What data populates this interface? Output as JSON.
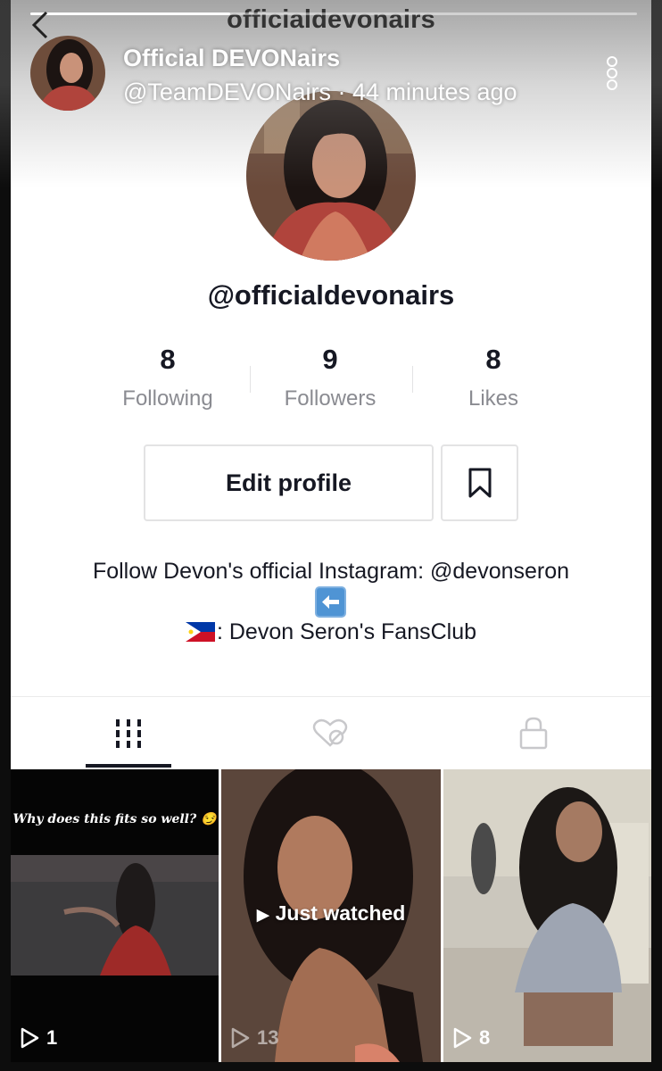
{
  "header": {
    "username": "officialdevonairs",
    "story_title": "Official DEVONairs",
    "story_meta": "@TeamDEVONairs · 44 minutes ago",
    "story_progress": 0.33
  },
  "profile": {
    "handle": "@officialdevonairs",
    "stats": [
      {
        "value": "8",
        "label": "Following"
      },
      {
        "value": "9",
        "label": "Followers"
      },
      {
        "value": "8",
        "label": "Likes"
      }
    ],
    "edit_label": "Edit profile",
    "bio_line1": "Follow Devon's official Instagram: @devonseron",
    "bio_emoji1": "back-arrow",
    "bio_line2": ": Devon Seron's FansClub",
    "bio_emoji2": "philippines-flag"
  },
  "tabs": [
    {
      "name": "videos",
      "icon": "grid-icon",
      "active": true
    },
    {
      "name": "liked",
      "icon": "liked-private-icon",
      "active": false
    },
    {
      "name": "private",
      "icon": "lock-icon",
      "active": false
    }
  ],
  "videos": [
    {
      "caption": "Why does this fits so well? 😏",
      "views": "1"
    },
    {
      "overlay": "Just watched",
      "views": "13"
    },
    {
      "views": "8"
    }
  ],
  "colors": {
    "text": "#161823",
    "secondary_text": "#8a8b91",
    "border": "#e3e3e4"
  }
}
